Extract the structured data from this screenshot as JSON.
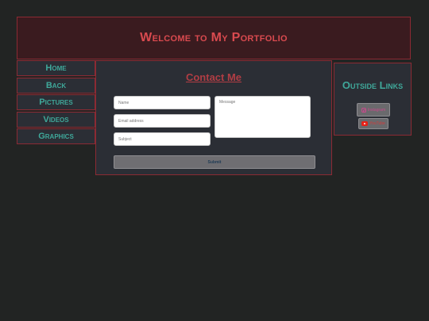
{
  "header": {
    "title": "Welcome to My Portfolio"
  },
  "nav": {
    "items": [
      {
        "label": "Home"
      },
      {
        "label": "Back"
      },
      {
        "label": "Pictures"
      },
      {
        "label": "Videos"
      },
      {
        "label": "Graphics"
      }
    ]
  },
  "contact": {
    "title": "Contact Me",
    "name_placeholder": "Name",
    "email_placeholder": "Email address",
    "subject_placeholder": "Subject",
    "message_placeholder": "Message",
    "submit_label": "Submit"
  },
  "outside_links": {
    "title": "Outside Links",
    "links": [
      {
        "label": "Instagram",
        "icon": "instagram-icon"
      },
      {
        "label": "YouTube",
        "icon": "youtube-icon"
      }
    ]
  },
  "colors": {
    "background": "#222423",
    "panel": "#2b2e35",
    "border": "#8b2a33",
    "header_bg": "#3a1b1f",
    "header_text": "#d94a4f",
    "accent_teal": "#3fa89a",
    "contact_title": "#b03d44"
  }
}
